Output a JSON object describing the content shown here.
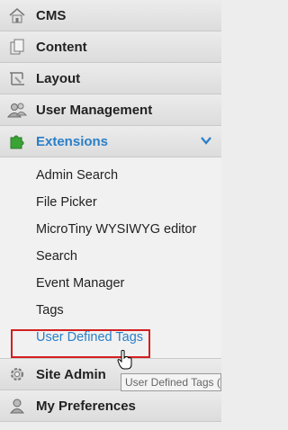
{
  "menu": {
    "top_items": [
      {
        "label": "CMS",
        "icon": "home-icon"
      },
      {
        "label": "Content",
        "icon": "pages-icon"
      },
      {
        "label": "Layout",
        "icon": "layout-icon"
      },
      {
        "label": "User Management",
        "icon": "users-icon"
      }
    ],
    "extensions": {
      "label": "Extensions",
      "icon": "puzzle-icon",
      "chevron": "chevron-down-icon",
      "sub_items": [
        "Admin Search",
        "File Picker",
        "MicroTiny WYSIWYG editor",
        "Search",
        "Event Manager",
        "Tags",
        "User Defined Tags"
      ]
    },
    "bottom_items": [
      {
        "label": "Site Admin",
        "icon": "gear-icon"
      },
      {
        "label": "My Preferences",
        "icon": "user-icon"
      }
    ]
  },
  "tooltip": {
    "text": "User Defined Tags (U"
  },
  "colors": {
    "accent": "#2a7fc7",
    "highlight_border": "#d42020"
  }
}
